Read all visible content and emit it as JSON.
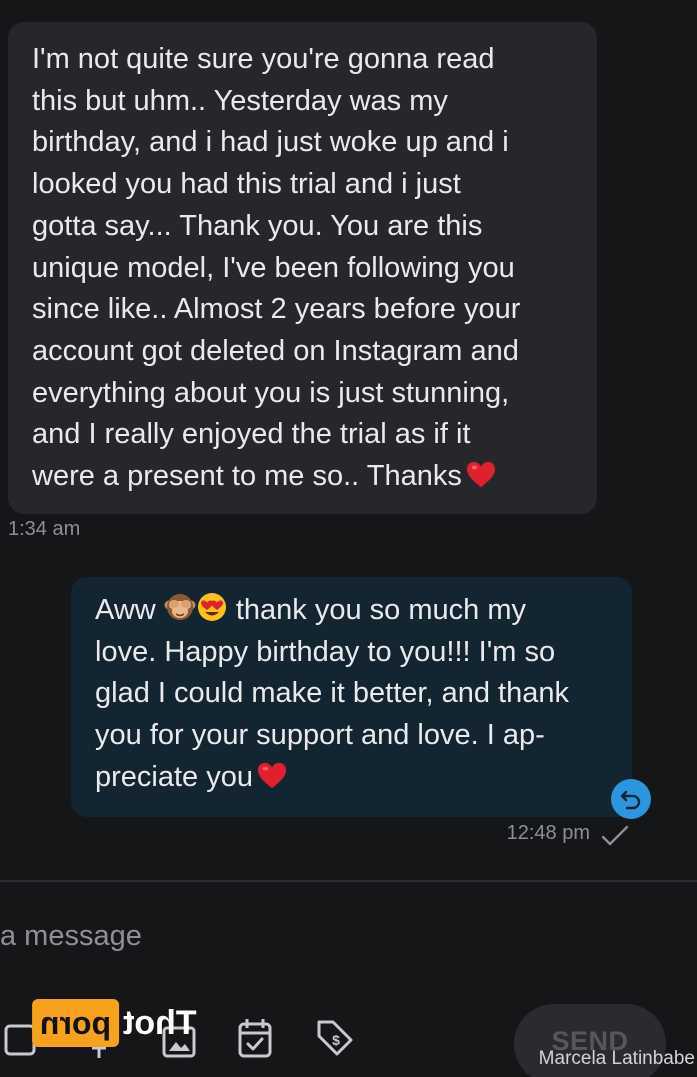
{
  "conversation": {
    "incoming": {
      "text": "I'm not quite sure you're gonna read\nthis but uhm.. Yesterday was my\nbirthday, and i had just woke up and i\nlooked you had this trial and i just\ngotta say... Thank you. You are this\nunique model, I've been following you\nsince like.. Almost 2 years before your\naccount got deleted on Instagram and\neverything about you is just stunning,\nand I really enjoyed the trial as if it\nwere a present to me so.. Thanks",
      "emoji": "red-heart",
      "time": "1:34 am"
    },
    "outgoing": {
      "text_a": "Aww",
      "text_b": "thank you so much my\nlove. Happy birthday to you!!! I'm so\nglad I could make it better, and thank\nyou for your support and love. I ap-\npreciate you",
      "emojis": [
        "see-no-evil-monkey",
        "heart-eyes-face",
        "red-heart"
      ],
      "time": "12:48 pm",
      "status_icon": "check-icon"
    }
  },
  "composer": {
    "placeholder": "a message",
    "send_label": "SEND",
    "icons": [
      "square-icon",
      "pin-icon",
      "image-icon",
      "calendar-icon",
      "price-tag-icon"
    ]
  },
  "watermark": {
    "logo_box": "porn",
    "logo_text": "Thot",
    "credit": "Marcela Latinbabe"
  },
  "colors": {
    "background": "#151618",
    "incoming_bubble": "#26272b",
    "outgoing_bubble": "#142532",
    "accent": "#2c95dd",
    "heart": "#e0202e"
  }
}
